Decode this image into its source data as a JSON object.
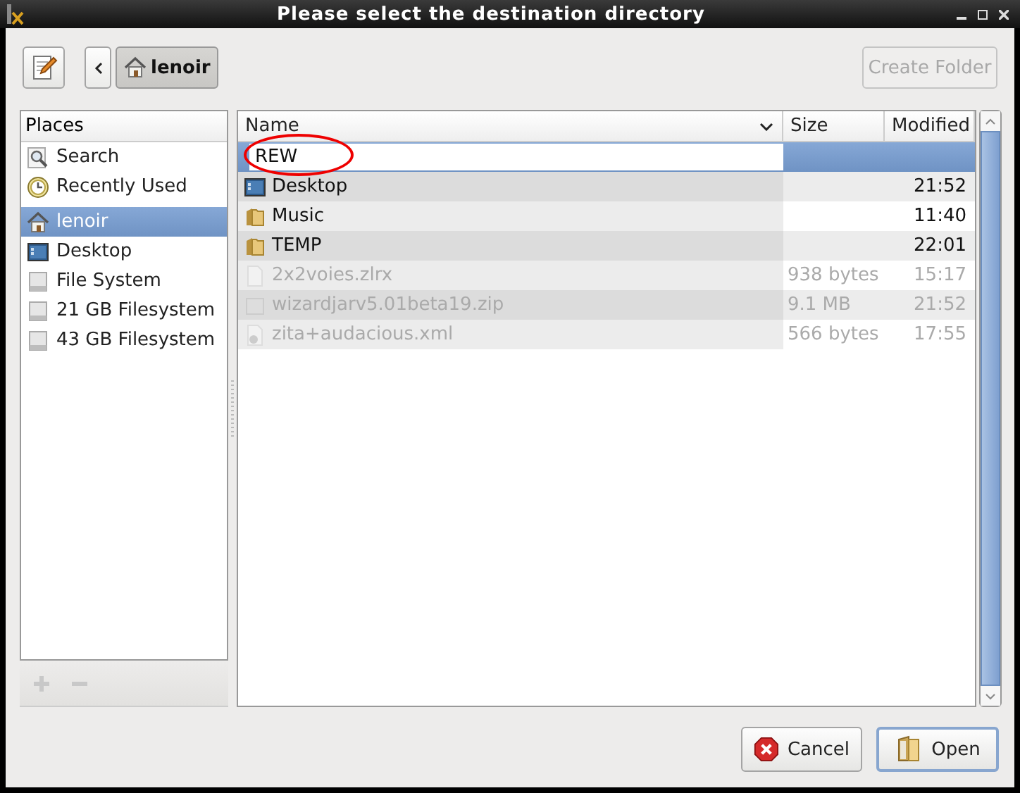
{
  "window": {
    "title": "Please select the destination directory"
  },
  "toolbar": {
    "path": [
      {
        "label": "lenoir",
        "selected": true
      }
    ],
    "create_folder": {
      "label": "Create Folder",
      "disabled": true
    }
  },
  "places": {
    "header": {
      "label": "Places"
    },
    "items": [
      {
        "label": "Search",
        "kind": "search",
        "selected": false,
        "separator_above": false
      },
      {
        "label": "Recently Used",
        "kind": "recent",
        "selected": false,
        "separator_above": false
      },
      {
        "label": "lenoir",
        "kind": "home",
        "selected": true,
        "separator_above": true
      },
      {
        "label": "Desktop",
        "kind": "desktop",
        "selected": false,
        "separator_above": false
      },
      {
        "label": "File System",
        "kind": "drive",
        "selected": false,
        "separator_above": false
      },
      {
        "label": "21 GB Filesystem",
        "kind": "drive",
        "selected": false,
        "separator_above": false
      },
      {
        "label": "43 GB Filesystem",
        "kind": "drive",
        "selected": false,
        "separator_above": false
      }
    ],
    "add_disabled": true,
    "remove_disabled": true
  },
  "files": {
    "columns": [
      "Name",
      "Size",
      "Modified"
    ],
    "location_entry": {
      "value": "REW",
      "circled": true
    },
    "rows": [
      {
        "name": "Desktop",
        "modified": "21:52",
        "kind": "desktop",
        "disabled": false
      },
      {
        "name": "Music",
        "modified": "11:40",
        "kind": "folder",
        "disabled": false
      },
      {
        "name": "TEMP",
        "modified": "22:01",
        "kind": "folder",
        "disabled": false
      },
      {
        "name": "2x2voies.zlrx",
        "size": "938 bytes",
        "modified": "15:17",
        "kind": "file",
        "disabled": true
      },
      {
        "name": "wizardjarv5.01beta19.zip",
        "size": "9.1 MB",
        "modified": "21:52",
        "kind": "archive",
        "disabled": true
      },
      {
        "name": "zita+audacious.xml",
        "size": "566 bytes",
        "modified": "17:55",
        "kind": "xml",
        "disabled": true
      }
    ]
  },
  "buttons": [
    {
      "label": "Cancel",
      "kind": "cancel",
      "focused": false
    },
    {
      "label": "Open",
      "kind": "open",
      "focused": true
    }
  ]
}
